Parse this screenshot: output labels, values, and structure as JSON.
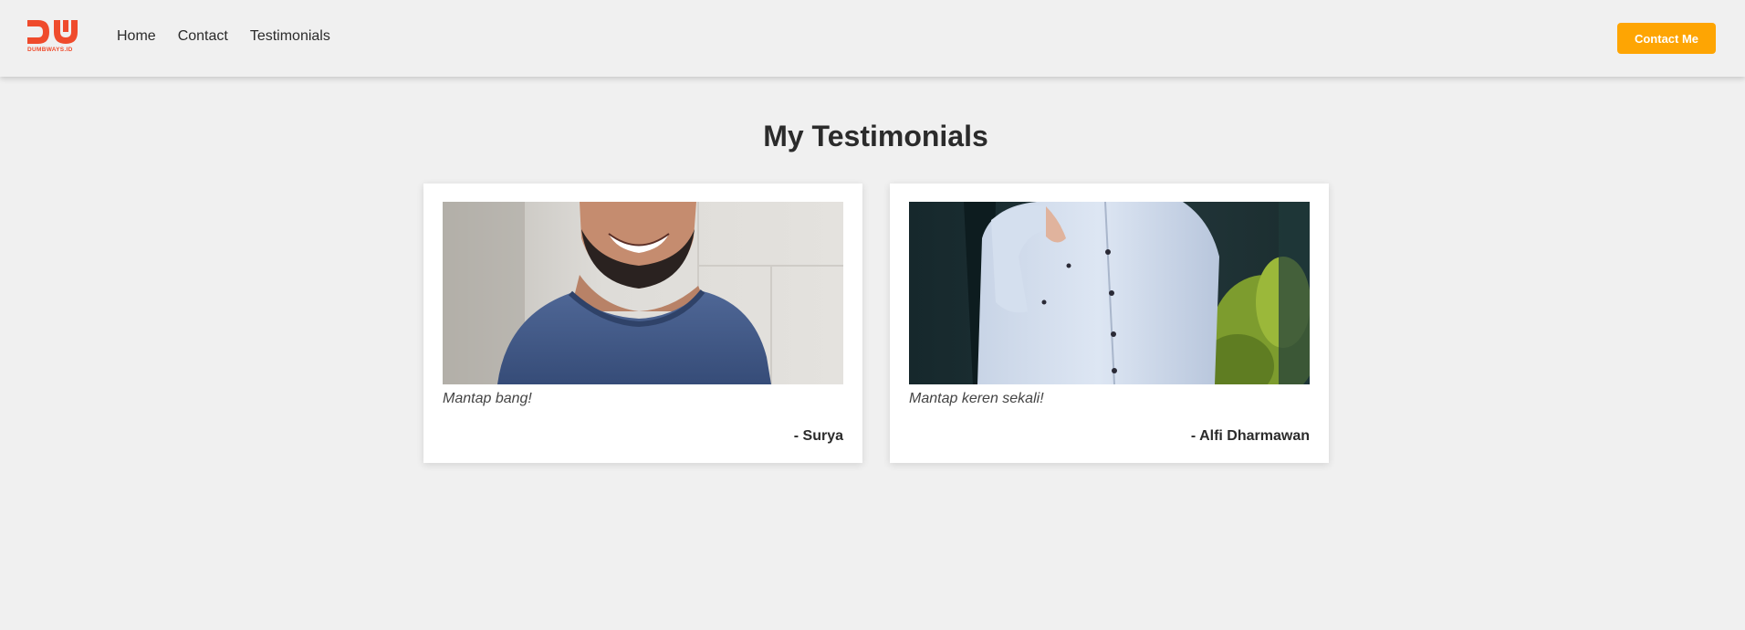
{
  "brand": {
    "logo_text": "DUMBWAYS.ID",
    "color": "#ef4b2c"
  },
  "nav": {
    "links": [
      "Home",
      "Contact",
      "Testimonials"
    ],
    "cta_label": "Contact Me",
    "cta_color": "#fea503"
  },
  "main": {
    "title": "My Testimonials",
    "testimonials": [
      {
        "quote": "Mantap bang!",
        "author": "- Surya",
        "image": "smiling-man-blue-tshirt-photo"
      },
      {
        "quote": "Mantap keren sekali!",
        "author": "- Alfi Dharmawan",
        "image": "man-light-blue-shirt-photo"
      }
    ]
  }
}
